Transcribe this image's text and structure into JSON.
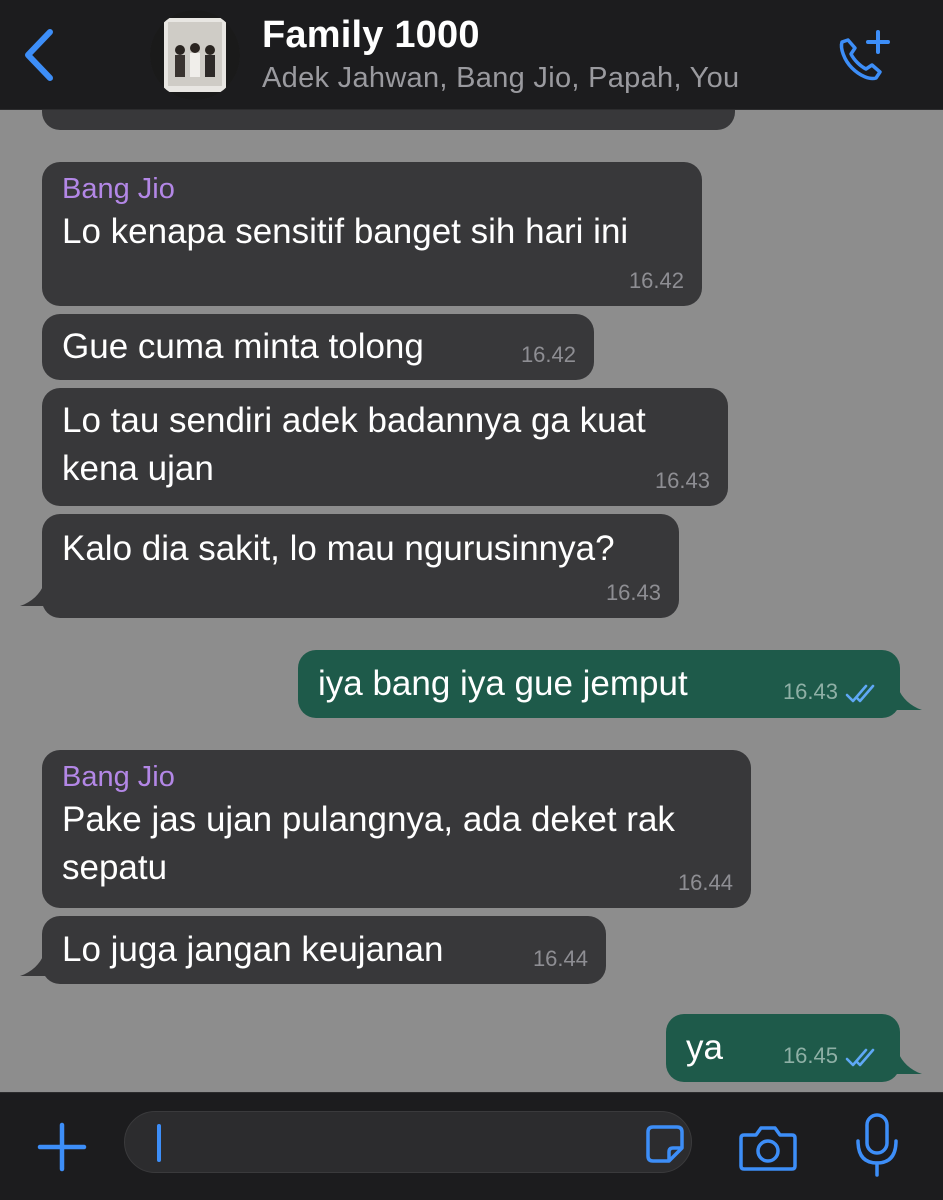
{
  "header": {
    "title": "Family 1000",
    "subtitle": "Adek Jahwan, Bang Jio, Papah, You"
  },
  "messages": [
    {
      "sender": "Bang Jio",
      "text": "Lo kenapa sensitif banget sih hari ini",
      "time": "16.42",
      "direction": "in"
    },
    {
      "text": "Gue cuma minta tolong",
      "time": "16.42",
      "direction": "in"
    },
    {
      "text_lines": [
        "Lo tau sendiri adek badannya ga kuat",
        "kena ujan"
      ],
      "time": "16.43",
      "direction": "in"
    },
    {
      "text": "Kalo dia sakit, lo mau ngurusinnya?",
      "time": "16.43",
      "direction": "in"
    },
    {
      "text": "iya bang iya gue jemput",
      "time": "16.43",
      "direction": "out",
      "status": "read"
    },
    {
      "sender": "Bang Jio",
      "text_lines": [
        "Pake jas ujan pulangnya, ada deket rak",
        "sepatu"
      ],
      "time": "16.44",
      "direction": "in"
    },
    {
      "text": "Lo juga jangan keujanan",
      "time": "16.44",
      "direction": "in"
    },
    {
      "text": "ya",
      "time": "16.45",
      "direction": "out",
      "status": "read"
    }
  ],
  "icons": {
    "back": "chevron-left-icon",
    "call": "phone-plus-icon",
    "attach": "plus-icon",
    "sticker": "sticker-icon",
    "camera": "camera-icon",
    "mic": "microphone-icon"
  },
  "colors": {
    "accent": "#3d8ef8",
    "incoming_bubble": "#38383a",
    "outgoing_bubble": "#1e5a4a",
    "sender_name": "#b387e6",
    "chat_background": "#8d8d8d",
    "bar_background": "#1c1c1e"
  }
}
